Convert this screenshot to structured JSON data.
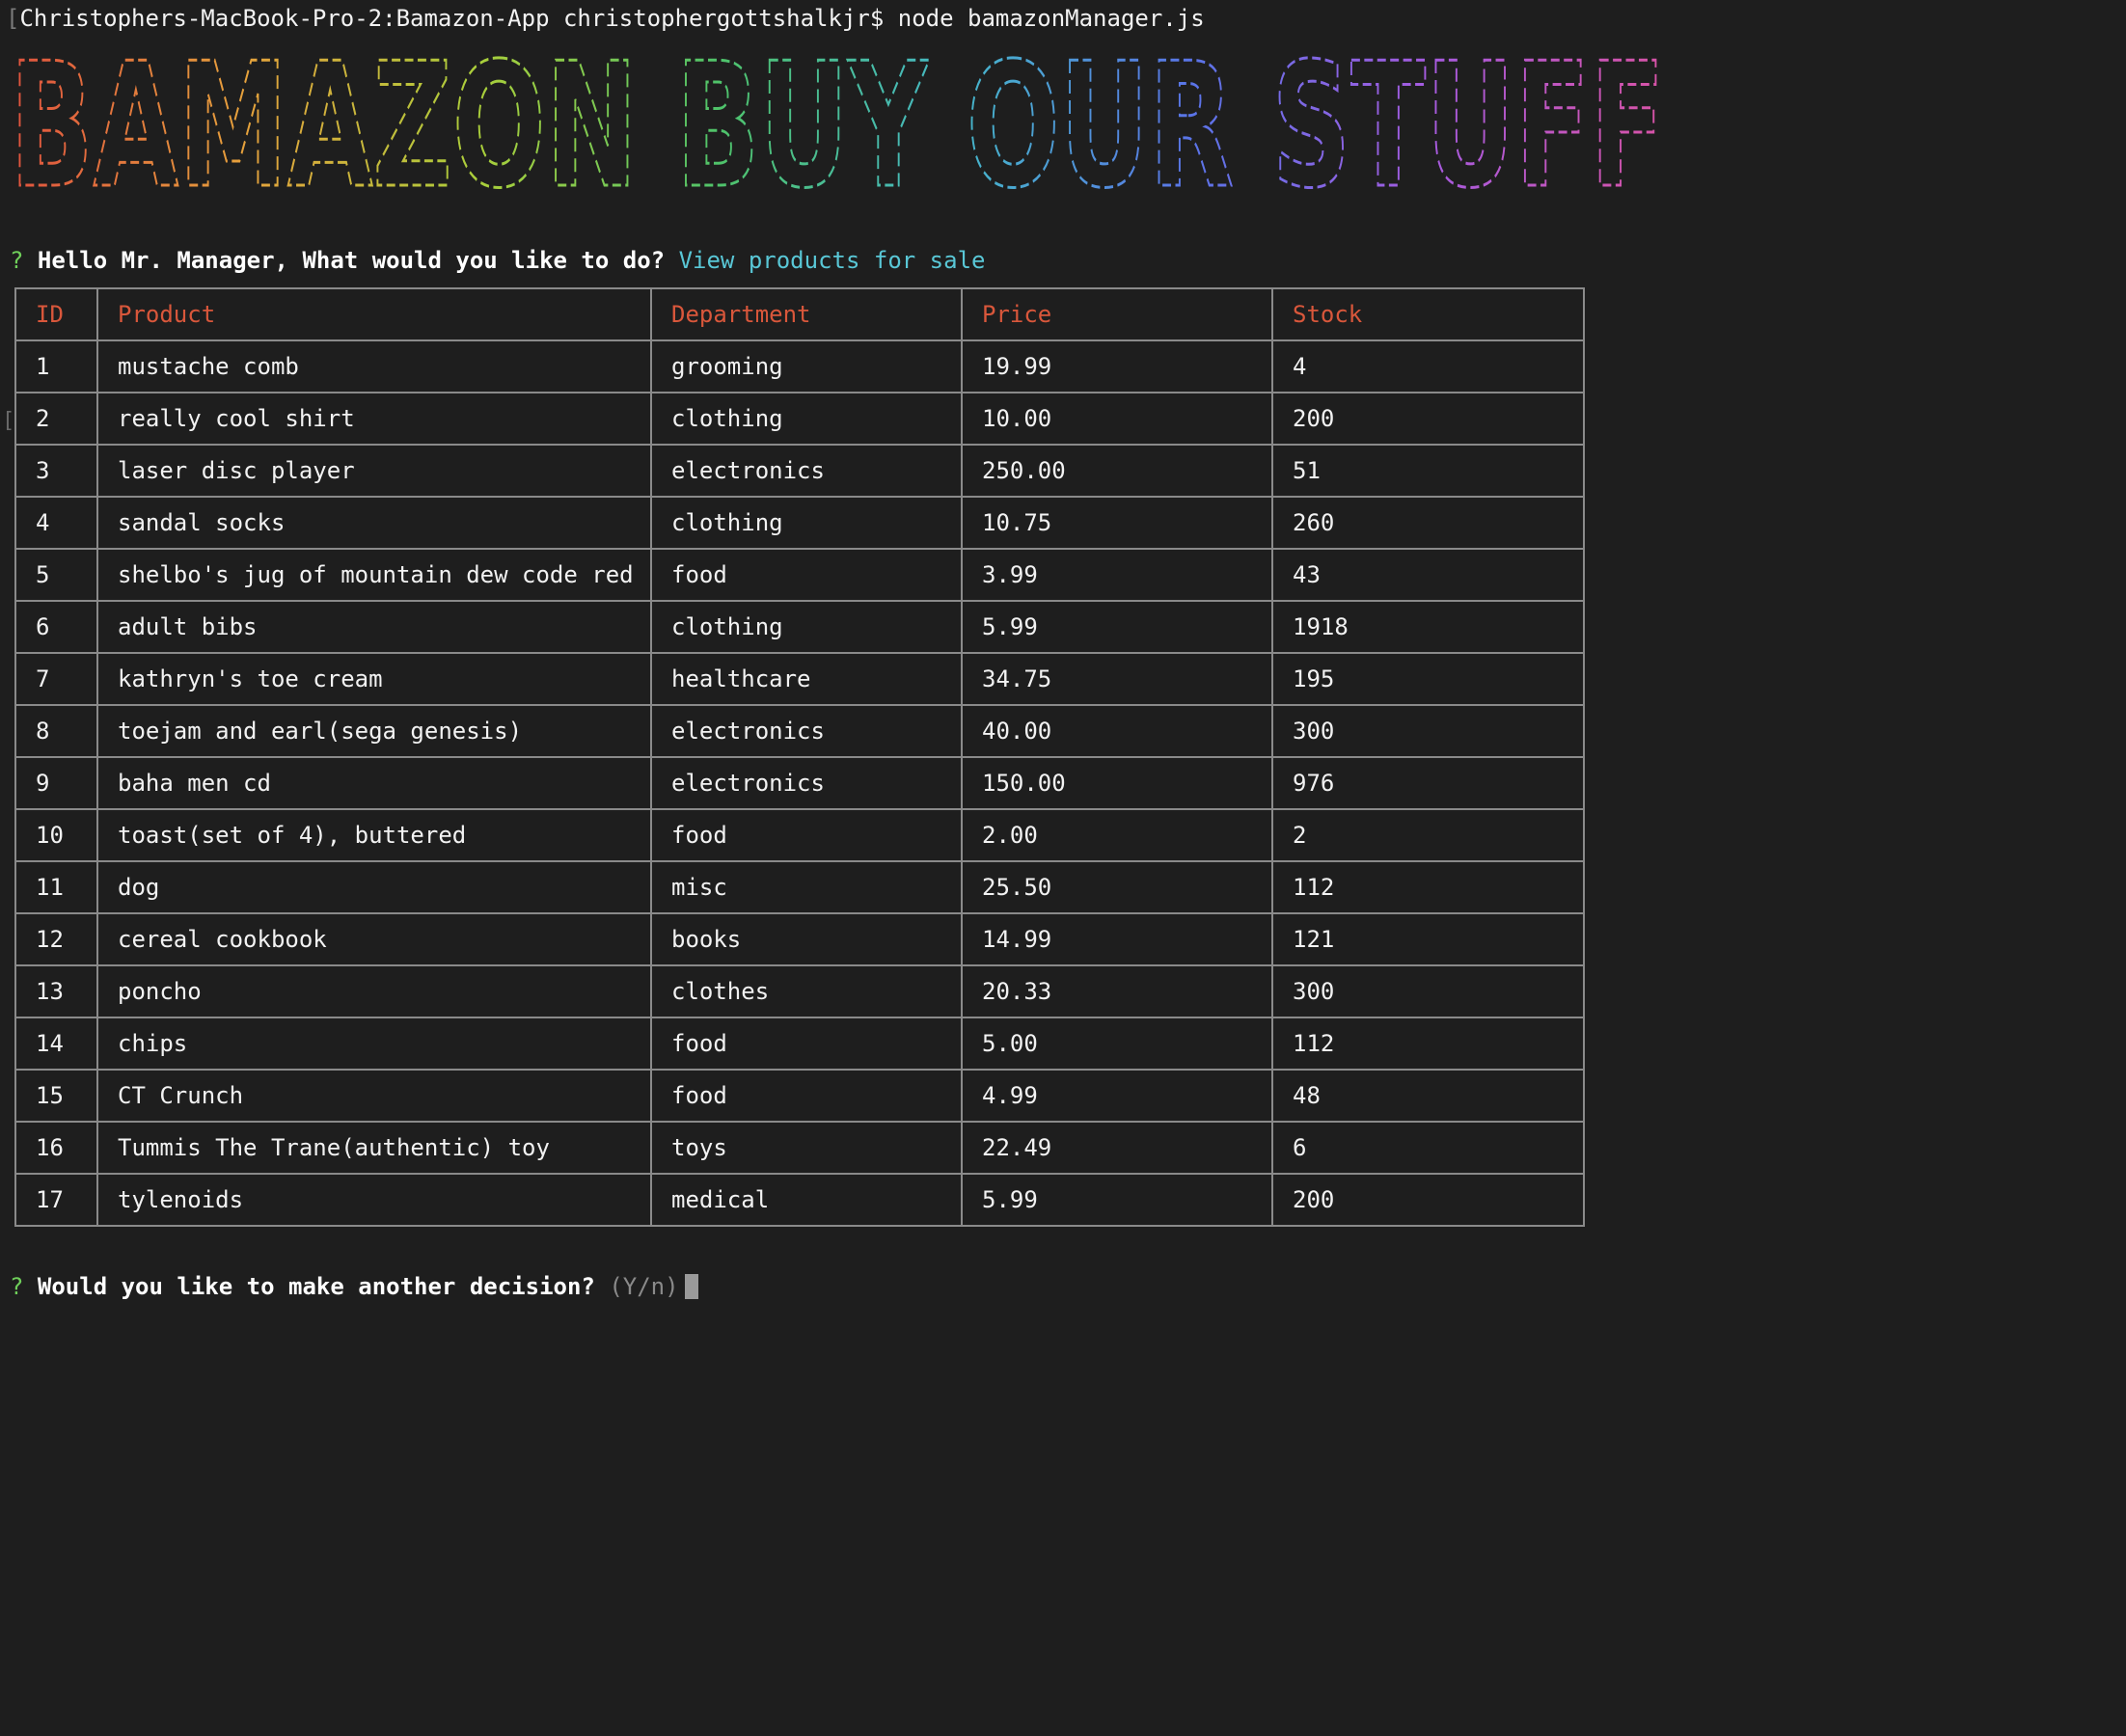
{
  "terminal": {
    "left_bracket": "[",
    "command_prompt": "Christophers-MacBook-Pro-2:Bamazon-App christophergottshalkjr$ node bamazonManager.js",
    "gutter_bracket": "["
  },
  "banner": {
    "text": "BAMAZON BUY OUR STUFF",
    "colors": [
      "#e0523e",
      "#e6a23c",
      "#a9cf3b",
      "#4fc36a",
      "#45b8c9",
      "#5a74e8",
      "#a65be0",
      "#d953a6"
    ]
  },
  "prompt1": {
    "marker": "?",
    "question": "Hello Mr. Manager, What would you like to do?",
    "answer": "View products for sale"
  },
  "table": {
    "headers": [
      "ID",
      "Product",
      "Department",
      "Price",
      "Stock"
    ],
    "rows": [
      [
        "1",
        "mustache comb",
        "grooming",
        "19.99",
        "4"
      ],
      [
        "2",
        "really cool shirt",
        "clothing",
        "10.00",
        "200"
      ],
      [
        "3",
        "laser disc player",
        "electronics",
        "250.00",
        "51"
      ],
      [
        "4",
        "sandal socks",
        "clothing",
        "10.75",
        "260"
      ],
      [
        "5",
        "shelbo's jug of mountain dew code red",
        "food",
        "3.99",
        "43"
      ],
      [
        "6",
        "adult bibs",
        "clothing",
        "5.99",
        "1918"
      ],
      [
        "7",
        "kathryn's toe cream",
        "healthcare",
        "34.75",
        "195"
      ],
      [
        "8",
        "toejam and earl(sega genesis)",
        "electronics",
        "40.00",
        "300"
      ],
      [
        "9",
        "baha men cd",
        "electronics",
        "150.00",
        "976"
      ],
      [
        "10",
        "toast(set of 4), buttered",
        "food",
        "2.00",
        "2"
      ],
      [
        "11",
        "dog",
        "misc",
        "25.50",
        "112"
      ],
      [
        "12",
        "cereal cookbook",
        "books",
        "14.99",
        "121"
      ],
      [
        "13",
        "poncho",
        "clothes",
        "20.33",
        "300"
      ],
      [
        "14",
        "chips",
        "food",
        "5.00",
        "112"
      ],
      [
        "15",
        "CT Crunch",
        "food",
        "4.99",
        "48"
      ],
      [
        "16",
        "Tummis The Trane(authentic) toy",
        "toys",
        "22.49",
        "6"
      ],
      [
        "17",
        "tylenoids",
        "medical",
        "5.99",
        "200"
      ]
    ]
  },
  "prompt2": {
    "marker": "?",
    "question": "Would you like to make another decision?",
    "hint": "(Y/n)"
  },
  "colors": {
    "background": "#1e1e1e",
    "header_text": "#d9573b",
    "answer_text": "#59c7d6",
    "prompt_marker": "#6fcf5a",
    "table_border": "#8a8a8a"
  }
}
